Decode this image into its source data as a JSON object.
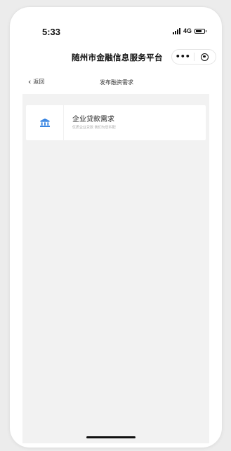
{
  "status_bar": {
    "time": "5:33",
    "network": "4G"
  },
  "app_header": {
    "title": "随州市金融信息服务平台",
    "more_label": "•••"
  },
  "nav": {
    "back_label": "返回",
    "title": "发布融资需求"
  },
  "card": {
    "title": "企业贷款需求",
    "subtitle": "优质企业贷款 我们为您匹配",
    "icon": "bank-icon",
    "accent_color": "#2f7fe0"
  }
}
